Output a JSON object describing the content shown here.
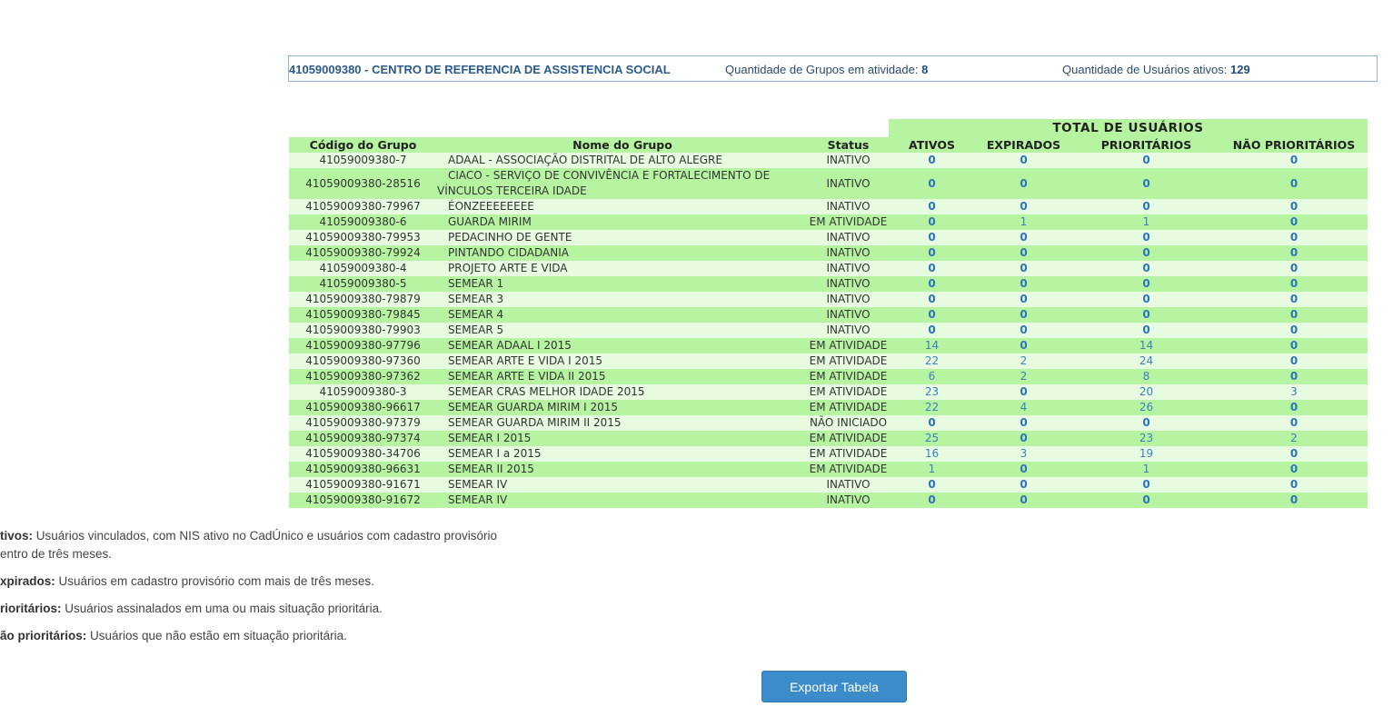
{
  "info": {
    "center_name": "41059009380 - CENTRO DE REFERENCIA DE ASSISTENCIA SOCIAL",
    "groups_label": "Quantidade de Grupos em atividade:",
    "groups_value": "8",
    "users_label": "Quantidade de Usuários ativos:",
    "users_value": "129"
  },
  "table": {
    "total_header": "TOTAL DE USUÁRIOS",
    "columns": [
      "Código do Grupo",
      "Nome do Grupo",
      "Status",
      "ATIVOS",
      "EXPIRADOS",
      "PRIORITÁRIOS",
      "NÃO PRIORITÁRIOS"
    ],
    "rows": [
      {
        "code": "41059009380-7",
        "name": "ADAAL - ASSOCIAÇÃO DISTRITAL DE ALTO ALEGRE",
        "status": "INATIVO",
        "ativos": "0",
        "expirados": "0",
        "prioritarios": "0",
        "nao_prioritarios": "0"
      },
      {
        "code": "41059009380-28516",
        "name": "CIACO - SERVIÇO DE CONVIVÊNCIA E FORTALECIMENTO DE VÍNCULOS TERCEIRA IDADE",
        "status": "INATIVO",
        "ativos": "0",
        "expirados": "0",
        "prioritarios": "0",
        "nao_prioritarios": "0"
      },
      {
        "code": "41059009380-79967",
        "name": "ÉONZEEEEEEEE",
        "status": "INATIVO",
        "ativos": "0",
        "expirados": "0",
        "prioritarios": "0",
        "nao_prioritarios": "0"
      },
      {
        "code": "41059009380-6",
        "name": "GUARDA MIRIM",
        "status": "EM ATIVIDADE",
        "ativos": "0",
        "expirados": "1",
        "prioritarios": "1",
        "nao_prioritarios": "0"
      },
      {
        "code": "41059009380-79953",
        "name": "PEDACINHO DE GENTE",
        "status": "INATIVO",
        "ativos": "0",
        "expirados": "0",
        "prioritarios": "0",
        "nao_prioritarios": "0"
      },
      {
        "code": "41059009380-79924",
        "name": "PINTANDO CIDADANIA",
        "status": "INATIVO",
        "ativos": "0",
        "expirados": "0",
        "prioritarios": "0",
        "nao_prioritarios": "0"
      },
      {
        "code": "41059009380-4",
        "name": "PROJETO ARTE E VIDA",
        "status": "INATIVO",
        "ativos": "0",
        "expirados": "0",
        "prioritarios": "0",
        "nao_prioritarios": "0"
      },
      {
        "code": "41059009380-5",
        "name": "SEMEAR 1",
        "status": "INATIVO",
        "ativos": "0",
        "expirados": "0",
        "prioritarios": "0",
        "nao_prioritarios": "0"
      },
      {
        "code": "41059009380-79879",
        "name": "SEMEAR 3",
        "status": "INATIVO",
        "ativos": "0",
        "expirados": "0",
        "prioritarios": "0",
        "nao_prioritarios": "0"
      },
      {
        "code": "41059009380-79845",
        "name": "SEMEAR 4",
        "status": "INATIVO",
        "ativos": "0",
        "expirados": "0",
        "prioritarios": "0",
        "nao_prioritarios": "0"
      },
      {
        "code": "41059009380-79903",
        "name": "SEMEAR 5",
        "status": "INATIVO",
        "ativos": "0",
        "expirados": "0",
        "prioritarios": "0",
        "nao_prioritarios": "0"
      },
      {
        "code": "41059009380-97796",
        "name": "SEMEAR ADAAL I 2015",
        "status": "EM ATIVIDADE",
        "ativos": "14",
        "expirados": "0",
        "prioritarios": "14",
        "nao_prioritarios": "0"
      },
      {
        "code": "41059009380-97360",
        "name": "SEMEAR ARTE E VIDA I 2015",
        "status": "EM ATIVIDADE",
        "ativos": "22",
        "expirados": "2",
        "prioritarios": "24",
        "nao_prioritarios": "0"
      },
      {
        "code": "41059009380-97362",
        "name": "SEMEAR ARTE E VIDA II 2015",
        "status": "EM ATIVIDADE",
        "ativos": "6",
        "expirados": "2",
        "prioritarios": "8",
        "nao_prioritarios": "0"
      },
      {
        "code": "41059009380-3",
        "name": "SEMEAR CRAS MELHOR IDADE 2015",
        "status": "EM ATIVIDADE",
        "ativos": "23",
        "expirados": "0",
        "prioritarios": "20",
        "nao_prioritarios": "3"
      },
      {
        "code": "41059009380-96617",
        "name": "SEMEAR GUARDA MIRIM I 2015",
        "status": "EM ATIVIDADE",
        "ativos": "22",
        "expirados": "4",
        "prioritarios": "26",
        "nao_prioritarios": "0"
      },
      {
        "code": "41059009380-97379",
        "name": "SEMEAR GUARDA MIRIM II 2015",
        "status": "NÃO INICIADO",
        "ativos": "0",
        "expirados": "0",
        "prioritarios": "0",
        "nao_prioritarios": "0"
      },
      {
        "code": "41059009380-97374",
        "name": "SEMEAR I 2015",
        "status": "EM ATIVIDADE",
        "ativos": "25",
        "expirados": "0",
        "prioritarios": "23",
        "nao_prioritarios": "2"
      },
      {
        "code": "41059009380-34706",
        "name": "SEMEAR I a 2015",
        "status": "EM ATIVIDADE",
        "ativos": "16",
        "expirados": "3",
        "prioritarios": "19",
        "nao_prioritarios": "0"
      },
      {
        "code": "41059009380-96631",
        "name": "SEMEAR II 2015",
        "status": "EM ATIVIDADE",
        "ativos": "1",
        "expirados": "0",
        "prioritarios": "1",
        "nao_prioritarios": "0"
      },
      {
        "code": "41059009380-91671",
        "name": "SEMEAR IV",
        "status": "INATIVO",
        "ativos": "0",
        "expirados": "0",
        "prioritarios": "0",
        "nao_prioritarios": "0"
      },
      {
        "code": "41059009380-91672",
        "name": "SEMEAR IV",
        "status": "INATIVO",
        "ativos": "0",
        "expirados": "0",
        "prioritarios": "0",
        "nao_prioritarios": "0"
      }
    ]
  },
  "legend": [
    {
      "term": "tivos:",
      "text": " Usuários vinculados, com NIS ativo no CadÚnico e usuários com cadastro provisório",
      "text2": "entro de três meses."
    },
    {
      "term": "xpirados:",
      "text": " Usuários em cadastro provisório com mais de três meses."
    },
    {
      "term": "rioritários:",
      "text": " Usuários assinalados em uma ou mais situação prioritária."
    },
    {
      "term": "ão prioritários:",
      "text": " Usuários que não estão em situação prioritária."
    }
  ],
  "export_button": "Exportar Tabela",
  "colors": {
    "row_light": "#e6fbe0",
    "row_dark": "#b6f4a1",
    "number_blue": "#2f73b8",
    "button_blue": "#3b8cc8"
  }
}
